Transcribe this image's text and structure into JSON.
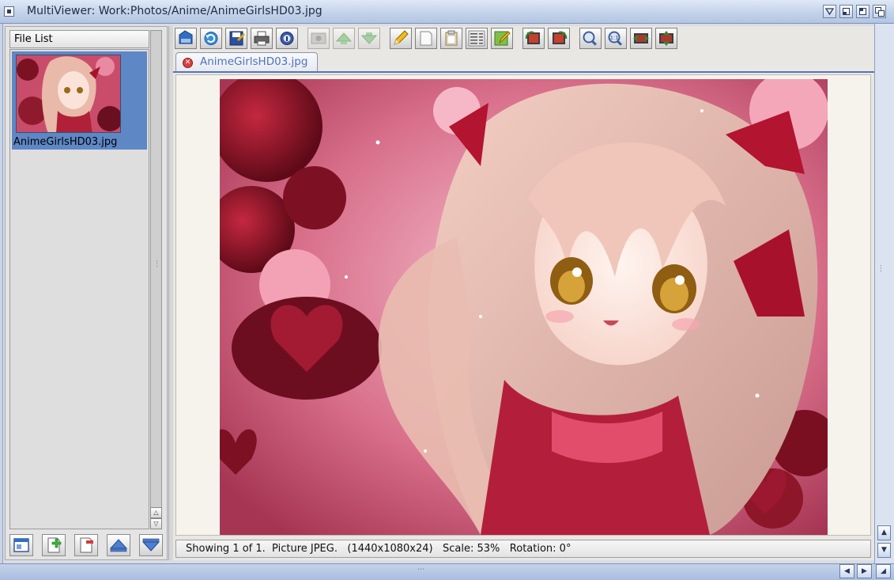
{
  "window": {
    "title": "MultiViewer: Work:Photos/Anime/AnimeGirlsHD03.jpg"
  },
  "file_list": {
    "header": "File List",
    "items": [
      {
        "name": "AnimeGirlsHD03.jpg",
        "selected": true
      }
    ]
  },
  "toolbar": {
    "buttons": [
      {
        "icon": "open-icon",
        "color": "#2f6fc4"
      },
      {
        "icon": "reload-icon",
        "color": "#2e8ad6"
      },
      {
        "icon": "save-icon",
        "color": "#2a4f9e"
      },
      {
        "icon": "print-icon",
        "color": "#555555"
      },
      {
        "icon": "info-icon",
        "color": "#3a5aa8"
      },
      {
        "icon": "view-icon",
        "color": "#8a8a8a"
      },
      {
        "icon": "arrow-up-icon",
        "color": "#4aa64a"
      },
      {
        "icon": "arrow-down-icon",
        "color": "#4aa64a"
      },
      {
        "icon": "pencil-icon",
        "color": "#e2a400"
      },
      {
        "icon": "copy-icon",
        "color": "#f0f0f0"
      },
      {
        "icon": "paste-icon",
        "color": "#f0e2b0"
      },
      {
        "icon": "statistics-icon",
        "color": "#c9c9c9"
      },
      {
        "icon": "edit-icon",
        "color": "#5b9d2f"
      },
      {
        "icon": "rotate-left-icon",
        "color": "#c6402f"
      },
      {
        "icon": "rotate-right-icon",
        "color": "#c6402f"
      },
      {
        "icon": "zoom-in-icon",
        "color": "#5a78b0"
      },
      {
        "icon": "zoom-one-to-one-icon",
        "color": "#5a78b0"
      },
      {
        "icon": "fit-width-icon",
        "color": "#a53a2f"
      },
      {
        "icon": "fit-height-icon",
        "color": "#a53a2f"
      }
    ],
    "ratio_label": "1:1"
  },
  "tab": {
    "label": "AnimeGirlsHD03.jpg"
  },
  "status": {
    "text": "Showing 1 of 1.  Picture JPEG.   (1440x1080x24)   Scale: 53%   Rotation: 0°"
  },
  "colors": {
    "accent": "#5e87c6",
    "tab_text": "#4e73b9",
    "titlebar": "#c4d3ea"
  }
}
